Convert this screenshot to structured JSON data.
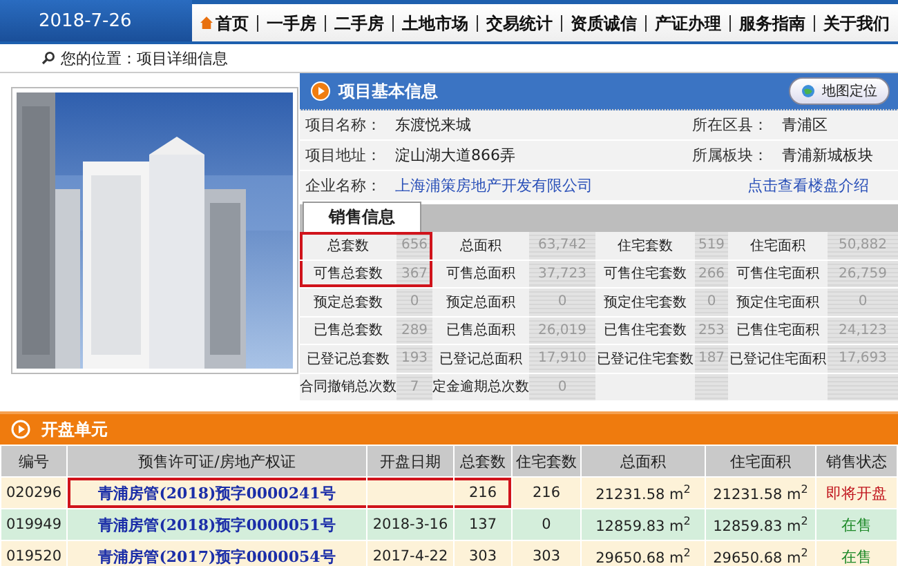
{
  "nav": {
    "date": "2018-7-26",
    "items": [
      {
        "label": "首页",
        "kind": "home"
      },
      {
        "label": "一手房",
        "kind": "link"
      },
      {
        "label": "二手房",
        "kind": "link"
      },
      {
        "label": "土地市场",
        "kind": "link"
      },
      {
        "label": "交易统计",
        "kind": "link"
      },
      {
        "label": "资质诚信",
        "kind": "link"
      },
      {
        "label": "产证办理",
        "kind": "link"
      },
      {
        "label": "服务指南",
        "kind": "link"
      },
      {
        "label": "关于我们",
        "kind": "link"
      }
    ]
  },
  "breadcrumb": "您的位置：项目详细信息",
  "project": {
    "title": "项目基本信息",
    "map_button": "地图定位",
    "rows": [
      {
        "left": {
          "label": "项目名称：",
          "value": "东渡悦来城",
          "kind": "text"
        },
        "right": {
          "label": "所在区县：",
          "value": "青浦区",
          "kind": "text"
        }
      },
      {
        "left": {
          "label": "项目地址：",
          "value": "淀山湖大道866弄",
          "kind": "text"
        },
        "right": {
          "label": "所属板块：",
          "value": "青浦新城板块",
          "kind": "text"
        }
      },
      {
        "left": {
          "label": "企业名称：",
          "value": "上海浦策房地产开发有限公司",
          "kind": "link"
        },
        "right": {
          "value": "点击查看楼盘介绍",
          "kind": "link"
        }
      }
    ]
  },
  "sales": {
    "tabs": [
      {
        "label": "销售信息",
        "selected": true
      }
    ],
    "rows": [
      [
        {
          "label": "总套数",
          "value": "656",
          "highlighted": true
        },
        {
          "label": "总面积",
          "value": "63,742",
          "highlighted": false
        },
        {
          "label": "住宅套数",
          "value": "519",
          "highlighted": false
        },
        {
          "label": "住宅面积",
          "value": "50,882",
          "highlighted": false
        }
      ],
      [
        {
          "label": "可售总套数",
          "value": "367",
          "highlighted": true
        },
        {
          "label": "可售总面积",
          "value": "37,723",
          "highlighted": false
        },
        {
          "label": "可售住宅套数",
          "value": "266",
          "highlighted": false
        },
        {
          "label": "可售住宅面积",
          "value": "26,759",
          "highlighted": false
        }
      ],
      [
        {
          "label": "预定总套数",
          "value": "0",
          "highlighted": false
        },
        {
          "label": "预定总面积",
          "value": "0",
          "highlighted": false
        },
        {
          "label": "预定住宅套数",
          "value": "0",
          "highlighted": false
        },
        {
          "label": "预定住宅面积",
          "value": "0",
          "highlighted": false
        }
      ],
      [
        {
          "label": "已售总套数",
          "value": "289",
          "highlighted": false
        },
        {
          "label": "已售总面积",
          "value": "26,019",
          "highlighted": false
        },
        {
          "label": "已售住宅套数",
          "value": "253",
          "highlighted": false
        },
        {
          "label": "已售住宅面积",
          "value": "24,123",
          "highlighted": false
        }
      ],
      [
        {
          "label": "已登记总套数",
          "value": "193",
          "highlighted": false
        },
        {
          "label": "已登记总面积",
          "value": "17,910",
          "highlighted": false
        },
        {
          "label": "已登记住宅套数",
          "value": "187",
          "highlighted": false
        },
        {
          "label": "已登记住宅面积",
          "value": "17,693",
          "highlighted": false
        }
      ],
      [
        {
          "label": "合同撤销总次数",
          "value": "7",
          "highlighted": false
        },
        {
          "label": "定金逾期总次数",
          "value": "0",
          "highlighted": false
        }
      ]
    ]
  },
  "units": {
    "title": "开盘单元",
    "columns": [
      "编号",
      "预售许可证/房地产权证",
      "开盘日期",
      "总套数",
      "住宅套数",
      "总面积",
      "住宅面积",
      "销售状态"
    ],
    "rows": [
      {
        "cells": [
          {
            "text": "020296",
            "highlighted": false
          },
          {
            "text": "青浦房管(2018)预字0000241号",
            "highlighted": true
          },
          {
            "highlighted": true
          },
          {
            "text": "216",
            "highlighted": true
          },
          {
            "text": "216",
            "highlighted": false
          },
          {
            "text": "21231.58 m$^{2}$",
            "highlighted": false
          },
          {
            "text": "21231.58 m$^{2}$",
            "highlighted": false
          }
        ],
        "status": {
          "text": "即将开盘",
          "color": "#c0141c"
        }
      },
      {
        "cells": [
          {
            "text": "019949",
            "highlighted": false
          },
          {
            "text": "青浦房管(2018)预字0000051号",
            "highlighted": false
          },
          {
            "text": "2018-3-16",
            "highlighted": false
          },
          {
            "text": "137",
            "highlighted": false
          },
          {
            "text": "0",
            "highlighted": false
          },
          {
            "text": "12859.83 m$^{2}$",
            "highlighted": false
          },
          {
            "text": "12859.83 m$^{2}$",
            "highlighted": false
          }
        ],
        "status": {
          "text": "在售",
          "color": "#1f8a2a"
        }
      },
      {
        "cells": [
          {
            "text": "019520",
            "highlighted": false
          },
          {
            "text": "青浦房管(2017)预字0000054号",
            "highlighted": false
          },
          {
            "text": "2017-4-22",
            "highlighted": false
          },
          {
            "text": "303",
            "highlighted": false
          },
          {
            "text": "303",
            "highlighted": false
          },
          {
            "text": "29650.68 m$^{2}$",
            "highlighted": false
          },
          {
            "text": "29650.68 m$^{2}$",
            "highlighted": false
          }
        ],
        "status": {
          "text": "在售",
          "color": "#1f8a2a"
        }
      }
    ]
  }
}
